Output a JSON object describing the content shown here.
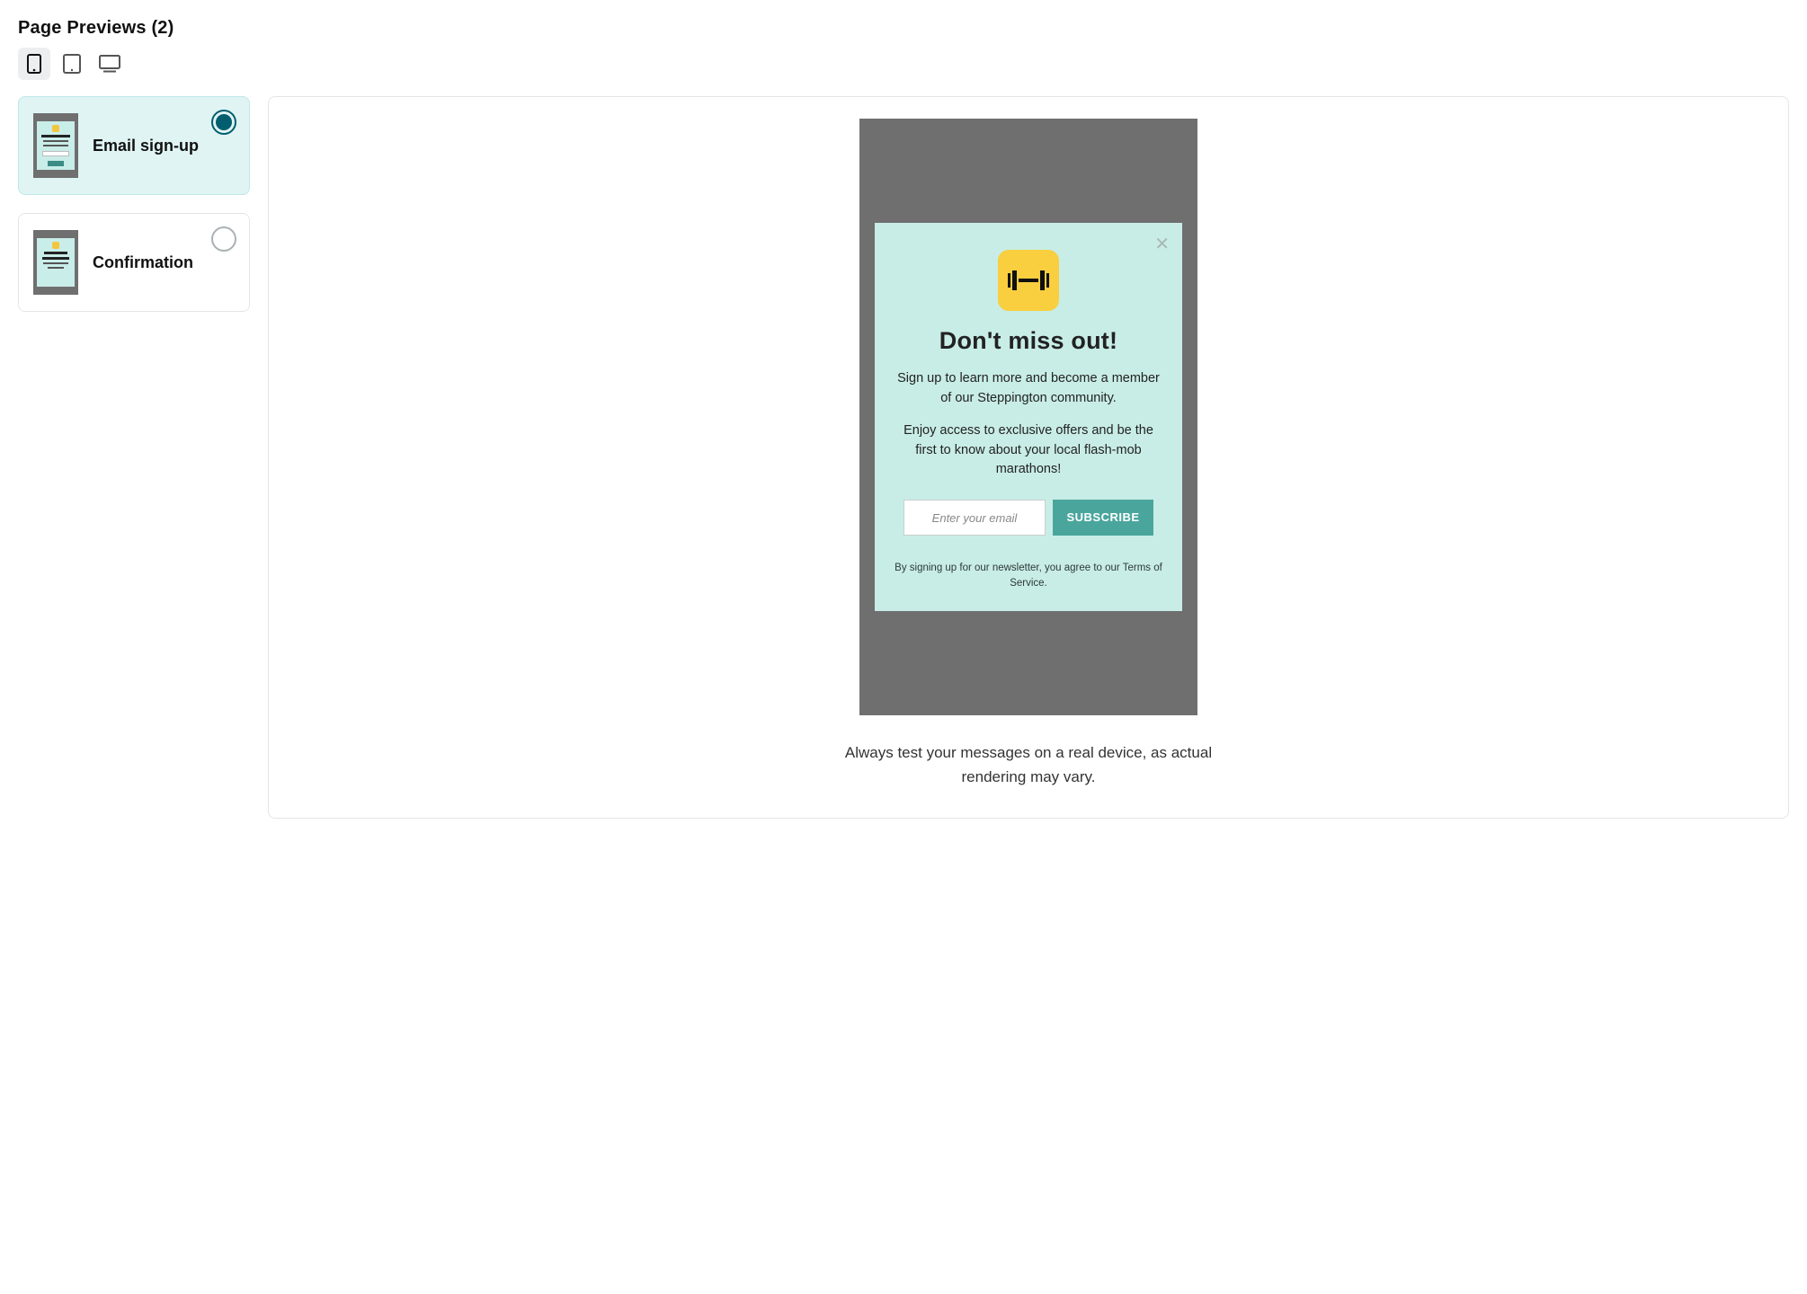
{
  "header": {
    "title": "Page Previews (2)"
  },
  "devices": {
    "phone": "phone",
    "tablet": "tablet",
    "desktop": "desktop"
  },
  "pages": [
    {
      "label": "Email sign-up",
      "selected": true
    },
    {
      "label": "Confirmation",
      "selected": false
    }
  ],
  "preview": {
    "heading": "Don't miss out!",
    "para1": "Sign up to learn more and become a member of our Steppington community.",
    "para2": "Enjoy access to exclusive offers and be the first to know about your local flash-mob marathons!",
    "email_placeholder": "Enter your email",
    "subscribe_label": "SUBSCRIBE",
    "fine_print": "By signing up for our newsletter, you agree to our Terms of Service.",
    "close_glyph": "✕"
  },
  "footnote": "Always test your messages on a real device, as actual rendering may vary."
}
